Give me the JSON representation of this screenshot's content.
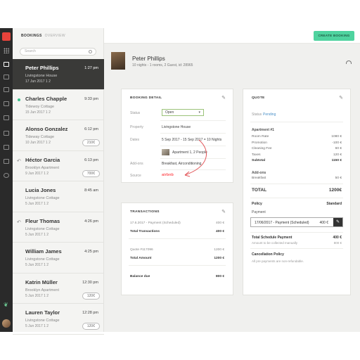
{
  "nav": {
    "tab_bookings": "BOOKINGS",
    "tab_overview": "OVERVIEW",
    "search_placeholder": "Search",
    "create_button": "CREATE BOOKING",
    "icons": [
      "grid-icon",
      "calendar-icon",
      "inbox-icon",
      "list-icon",
      "chat-icon",
      "monitor-icon",
      "phone-icon",
      "folder-icon",
      "tag-icon",
      "settings-icon",
      "leaf-icon",
      "avatar"
    ]
  },
  "bookings": [
    {
      "name": "Peter Phillips",
      "property": "Livingstone House",
      "meta": "17 Jun 2017   1   2",
      "time": "1:27 pm",
      "price": "",
      "selected": true,
      "marker": ""
    },
    {
      "name": "Charles Chapple",
      "property": "Tidewoy Cottage",
      "meta": "15 Jun 2017   1   2",
      "time": "9:33 pm",
      "price": "",
      "selected": false,
      "marker": "dot"
    },
    {
      "name": "Alonso Gonzalez",
      "property": "Tideway Cottage",
      "meta": "10 Jun 2017   1   2",
      "time": "6:12 pm",
      "price": "210€",
      "selected": false,
      "marker": ""
    },
    {
      "name": "Héctor Garcia",
      "property": "Brooklyn Apartment",
      "meta": "9 Jun 2017   1   2",
      "time": "6:13 pm",
      "price": "700€",
      "selected": false,
      "marker": "reply"
    },
    {
      "name": "Lucia Jones",
      "property": "Livingstone Cottage",
      "meta": "5 Jun 2017   1   2",
      "time": "8:45 am",
      "price": "",
      "selected": false,
      "marker": ""
    },
    {
      "name": "Fleur Thomas",
      "property": "Livingstone Cottage",
      "meta": "5 Jun 2017   1   2",
      "time": "4:26 pm",
      "price": "",
      "selected": false,
      "marker": "reply"
    },
    {
      "name": "William James",
      "property": "Livingstone Cottage",
      "meta": "5 Jun 2017   1   2",
      "time": "4:25 pm",
      "price": "",
      "selected": false,
      "marker": ""
    },
    {
      "name": "Katrin Müller",
      "property": "Brooklyn Apartment",
      "meta": "5 Jun 2017   1   2",
      "time": "12:30 pm",
      "price": "120€",
      "selected": false,
      "marker": ""
    },
    {
      "name": "Lauren Taylor",
      "property": "Livingstone Cottage",
      "meta": "5 Jun 2017   1   2",
      "time": "12:28 pm",
      "price": "120€",
      "selected": false,
      "marker": ""
    }
  ],
  "guest": {
    "name": "Peter Phillips",
    "summary": "10 nights - 1 rooms, 2 Guest, id: 28965"
  },
  "booking_detail": {
    "title": "BOOKING DETAIL",
    "status_label": "Status",
    "status_value": "Open",
    "property_label": "Property",
    "property_value": "Livingstone House",
    "dates_label": "Dates",
    "dates_value": "5 Sep 2017  -  15 Sep 2017  =  10 Nights",
    "room_value": "Apartment 1, 2 People",
    "addons_label": "Add-ons",
    "addons_value": "Breakfast, Airconditioning",
    "source_label": "Source",
    "source_value": "airbnb"
  },
  "transactions": {
    "title": "TRANSACTIONS",
    "rows": [
      {
        "label": "17.6.2017 - Payment (Scheduled)",
        "value": "400 €",
        "bold": false
      },
      {
        "label": "Total Transactions",
        "value": "400 €",
        "bold": true
      },
      {
        "label": "Quote  #117096",
        "value": "1200 €",
        "bold": false
      },
      {
        "label": "Total Amount",
        "value": "1200 €",
        "bold": true
      },
      {
        "label": "Balance due",
        "value": "800 €",
        "bold": true
      }
    ]
  },
  "quote": {
    "title": "QUOTE",
    "status_label": "Status",
    "status_value": "Pending",
    "apartment_header": "Apartment #1",
    "lines": [
      {
        "label": "Room Rate",
        "value": "1080 €"
      },
      {
        "label": "Promotion",
        "value": "-100 €"
      },
      {
        "label": "Cleaning Fee",
        "value": "60 €"
      },
      {
        "label": "Taxes",
        "value": "120 €"
      },
      {
        "label": "Subtotal",
        "value": "1150 €"
      }
    ],
    "addons_header": "Add-ons",
    "addon_lines": [
      {
        "label": "Breakfast",
        "value": "50 €"
      }
    ],
    "total_label": "TOTAL",
    "total_value": "1200€",
    "policy_label": "Policy",
    "policy_value": "Standard",
    "payment_label": "Payment",
    "payment_row_label": "17/06/2017 - Payment (Scheduled)",
    "payment_row_value": "400 €",
    "scheduled_label": "Total Schedule Payment",
    "scheduled_value": "400 €",
    "collected_label": "Amount to be collected manually",
    "collected_value": "800 €",
    "cancel_label": "Cancellation Policy",
    "cancel_text": "All pre payments are non-refundable."
  }
}
